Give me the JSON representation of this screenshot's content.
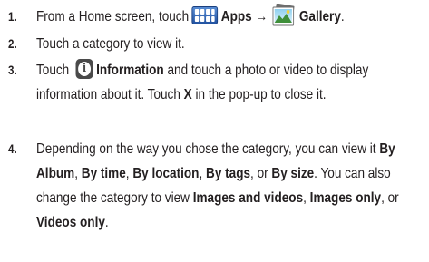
{
  "steps": [
    {
      "number": "1.",
      "t1": "From a Home screen, touch",
      "b1": "Apps →",
      "b2": "Gallery",
      "t2": "."
    },
    {
      "number": "2.",
      "t1": "Touch a category to view it."
    },
    {
      "number": "3.",
      "t1": "Touch",
      "b1": "Information",
      "t2": "and touch a photo or video to display information about it. Touch",
      "b2": "X",
      "t3": "in the pop-up to close it."
    },
    {
      "number": "4.",
      "t1": "Depending on the way you chose the category, you can view it",
      "b1": "By Album",
      "t2": ",",
      "b2": "By time",
      "t3": ",",
      "b3": "By location",
      "t4": ",",
      "b4": "By tags",
      "t5": ", or",
      "b5": "By size",
      "t6": ". You can also change the category to view",
      "b6": "Images and videos",
      "t7": ",",
      "b7": "Images only",
      "t8": ", or",
      "b8": "Videos only",
      "t9": "."
    }
  ],
  "icons": {
    "apps": "apps-icon",
    "gallery": "gallery-icon",
    "information": "info-icon"
  },
  "colors": {
    "text": "#231f20",
    "apps_icon": "#2d64b8",
    "info_icon": "#4a4a4a"
  }
}
